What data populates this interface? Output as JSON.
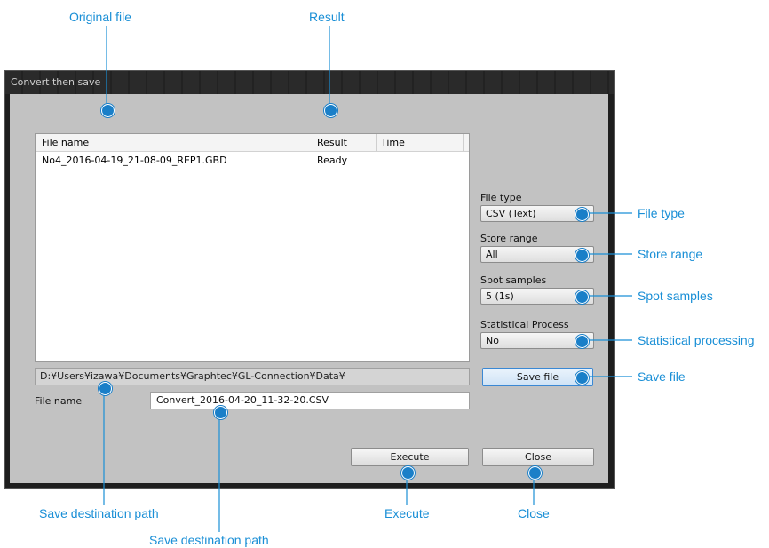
{
  "window": {
    "title": "Convert then save"
  },
  "file_list": {
    "columns": [
      "File name",
      "Result",
      "Time"
    ],
    "rows": [
      {
        "file_name": "No4_2016-04-19_21-08-09_REP1.GBD",
        "result": "Ready",
        "time": ""
      }
    ]
  },
  "save_path": "D:¥Users¥izawa¥Documents¥Graphtec¥GL-Connection¥Data¥",
  "file_name_field": {
    "label": "File name",
    "value": "Convert_2016-04-20_11-32-20.CSV"
  },
  "options": {
    "file_type": {
      "label": "File type",
      "value": "CSV (Text)"
    },
    "store_range": {
      "label": "Store range",
      "value": "All"
    },
    "spot_samples": {
      "label": "Spot samples",
      "value": "5 (1s)"
    },
    "statistical_process": {
      "label": "Statistical Process",
      "value": "No"
    }
  },
  "buttons": {
    "save_file": "Save file",
    "execute": "Execute",
    "close": "Close"
  },
  "callouts": {
    "original_file": "Original file",
    "result": "Result",
    "file_type": "File type",
    "store_range": "Store range",
    "spot_samples": "Spot samples",
    "statistical_processing": "Statistical processing",
    "save_file": "Save file",
    "save_destination_path_1": "Save destination path",
    "save_destination_path_2": "Save destination path",
    "execute": "Execute",
    "close": "Close"
  },
  "colors": {
    "callout": "#1a8fd6",
    "dot": "#1a7fc8",
    "dialog_bg": "#c2c2c2"
  }
}
